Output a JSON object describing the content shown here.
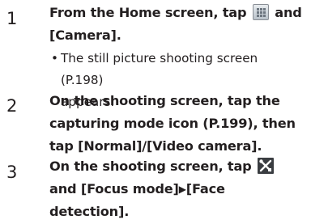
{
  "steps": [
    {
      "number": "1",
      "line1_before": "From the Home screen, tap ",
      "icon1": "apps-grid-icon",
      "line1_after": " and",
      "line2": "[Camera].",
      "note_bullet": "•",
      "note_line1": "The still picture shooting screen (P.198)",
      "note_line2": "appears."
    },
    {
      "number": "2",
      "line1": "On the shooting screen, tap the",
      "line2": "capturing mode icon (P.199), then",
      "line3": "tap [Normal]/[Video camera]."
    },
    {
      "number": "3",
      "line1_before": "On the shooting screen, tap ",
      "icon1": "settings-tools-icon",
      "line2_before": "and [Focus mode]",
      "arrow": "▶",
      "line2_after": "[Face",
      "line3": "detection]."
    }
  ]
}
